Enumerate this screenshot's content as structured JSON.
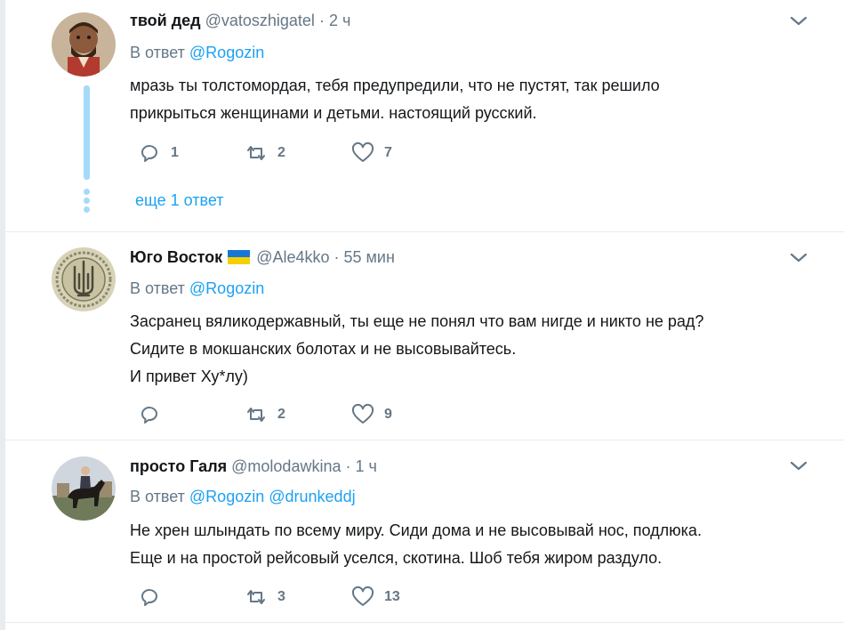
{
  "tweets": [
    {
      "fullname": "твой дед",
      "handle": "@vatoszhigatel",
      "time": "· 2 ч",
      "reply_prefix": "В ответ",
      "mentions": [
        "@Rogozin"
      ],
      "text_lines": [
        "мразь ты толстомордая, тебя предупредили, что не пустят, так решило",
        "прикрыться женщинами и детьми. настоящий русский."
      ],
      "replies": "1",
      "retweets": "2",
      "likes": "7",
      "more_replies": "еще 1 ответ",
      "avatar_icon": "portrait-avatar-icon"
    },
    {
      "fullname": "Юго Восток",
      "handle": "@Ale4kko",
      "time": "· 55 мин",
      "reply_prefix": "В ответ",
      "mentions": [
        "@Rogozin"
      ],
      "text_lines": [
        "Засранец вяликодержавный, ты еще не понял что вам нигде и никто не рад?",
        "Сидите в мокшанских болотах и не высовывайтесь.",
        "И привет Ху*лу)"
      ],
      "replies": "",
      "retweets": "2",
      "likes": "9",
      "avatar_icon": "trident-emblem-avatar-icon",
      "flag_colors": [
        "#1877d6",
        "#f5cf00"
      ]
    },
    {
      "fullname": "просто Галя",
      "handle": "@molodawkina",
      "time": "· 1 ч",
      "reply_prefix": "В ответ",
      "mentions": [
        "@Rogozin",
        "@drunkeddj"
      ],
      "text_lines": [
        "Не хрен шлындать по всему миру. Сиди дома и не высовывай нос, подлюка.",
        "Еще и на простой рейсовый уселся, скотина. Шоб тебя жиром раздуло."
      ],
      "replies": "",
      "retweets": "3",
      "likes": "13",
      "avatar_icon": "rider-on-horse-avatar-icon"
    }
  ],
  "colors": {
    "link": "#1da1f2",
    "muted": "#657786",
    "thread": "#a5daf8"
  }
}
